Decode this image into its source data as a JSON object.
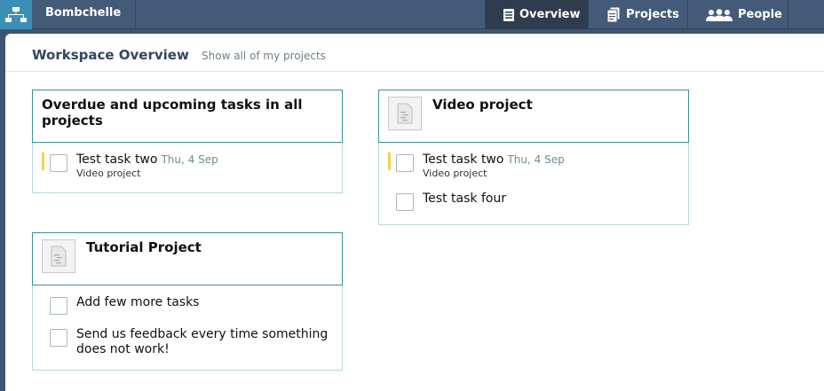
{
  "app": {
    "workspace_name": "Bombchelle"
  },
  "nav": {
    "overview": "Overview",
    "projects": "Projects",
    "people": "People"
  },
  "header": {
    "title": "Workspace Overview",
    "show_all_link": "Show all of my projects"
  },
  "cards": {
    "overdue": {
      "title": "Overdue and upcoming tasks in all projects",
      "tasks": [
        {
          "name": "Test task two",
          "date": "Thu, 4 Sep",
          "project": "Video project"
        }
      ]
    },
    "video": {
      "title": "Video project",
      "tasks": [
        {
          "name": "Test task two",
          "date": "Thu, 4 Sep",
          "project": "Video project"
        },
        {
          "name": "Test task four"
        }
      ]
    },
    "tutorial": {
      "title": "Tutorial Project",
      "tasks": [
        {
          "name": "Add few more tasks"
        },
        {
          "name": "Send us feedback every time something does not work!"
        }
      ]
    }
  },
  "colors": {
    "topbar": "#445a79",
    "card_border": "#3b8f9a",
    "due_marker": "#f3d34a"
  }
}
